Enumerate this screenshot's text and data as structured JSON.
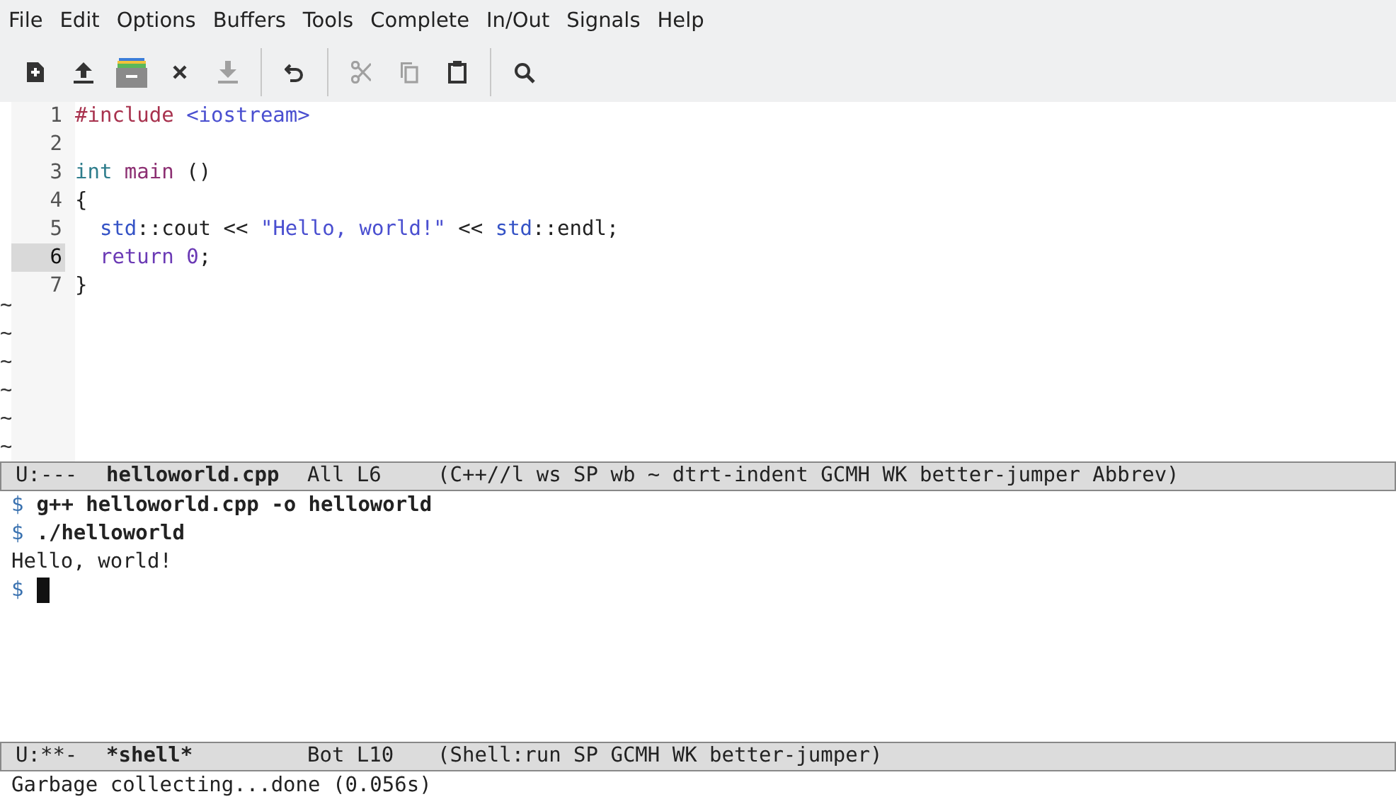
{
  "menu": [
    "File",
    "Edit",
    "Options",
    "Buffers",
    "Tools",
    "Complete",
    "In/Out",
    "Signals",
    "Help"
  ],
  "toolbar": [
    {
      "kind": "new",
      "disabled": false
    },
    {
      "kind": "upload",
      "disabled": false
    },
    {
      "kind": "archive",
      "disabled": false
    },
    {
      "kind": "close",
      "disabled": false
    },
    {
      "kind": "download",
      "disabled": true
    },
    {
      "kind": "sep"
    },
    {
      "kind": "undo",
      "disabled": false
    },
    {
      "kind": "sep"
    },
    {
      "kind": "cut",
      "disabled": true
    },
    {
      "kind": "copy",
      "disabled": true
    },
    {
      "kind": "paste",
      "disabled": false
    },
    {
      "kind": "sep"
    },
    {
      "kind": "search",
      "disabled": false
    }
  ],
  "editor": {
    "lines": [
      {
        "number": "1",
        "selected": false,
        "tokens": [
          {
            "kind": "preprocessor",
            "text": "#include"
          },
          {
            "kind": "string",
            "text": " <iostream>"
          }
        ]
      },
      {
        "number": "2",
        "selected": false
      },
      {
        "number": "3",
        "selected": false,
        "tokens": [
          {
            "kind": "type",
            "text": "int"
          },
          {
            "kind": "function",
            "text": " main"
          },
          {
            "kind": "plain",
            "text": " ()"
          }
        ]
      },
      {
        "number": "4",
        "selected": false,
        "tokens": [
          {
            "kind": "plain",
            "text": "{"
          }
        ]
      },
      {
        "number": "5",
        "selected": false,
        "tokens": [
          {
            "kind": "namespace",
            "text": "  std"
          },
          {
            "kind": "plain",
            "text": "::cout << "
          },
          {
            "kind": "string",
            "text": "\"Hello, world!\""
          },
          {
            "kind": "plain",
            "text": " << "
          },
          {
            "kind": "namespace",
            "text": "std"
          },
          {
            "kind": "plain",
            "text": "::endl;"
          }
        ]
      },
      {
        "number": "6",
        "selected": true,
        "tokens": [
          {
            "kind": "keyword",
            "text": "  return"
          },
          {
            "kind": "constant",
            "text": " 0"
          },
          {
            "kind": "plain",
            "text": ";"
          }
        ]
      },
      {
        "number": "7",
        "selected": false,
        "tokens": [
          {
            "kind": "plain",
            "text": "}"
          }
        ]
      }
    ],
    "empty_markers": [
      "~",
      "~",
      "~",
      "~",
      "~",
      "~"
    ]
  },
  "editor_modeline": {
    "state": "U:---",
    "buffer": "helloworld.cpp",
    "position": "All L6",
    "modes": "(C++//l ws SP wb ~ dtrt-indent GCMH WK better-jumper Abbrev)"
  },
  "shell": {
    "lines": [
      {
        "kind": "command",
        "prompt": "$",
        "text": "g++ helloworld.cpp -o helloworld"
      },
      {
        "kind": "command",
        "prompt": "$",
        "text": "./helloworld"
      },
      {
        "kind": "output",
        "text": "Hello, world!"
      },
      {
        "kind": "input",
        "prompt": "$"
      }
    ]
  },
  "shell_modeline": {
    "state": "U:**-",
    "buffer": "*shell*",
    "position": "Bot L10",
    "modes": "(Shell:run SP GCMH WK better-jumper)"
  },
  "echo_area": "Garbage collecting...done (0.056s)"
}
